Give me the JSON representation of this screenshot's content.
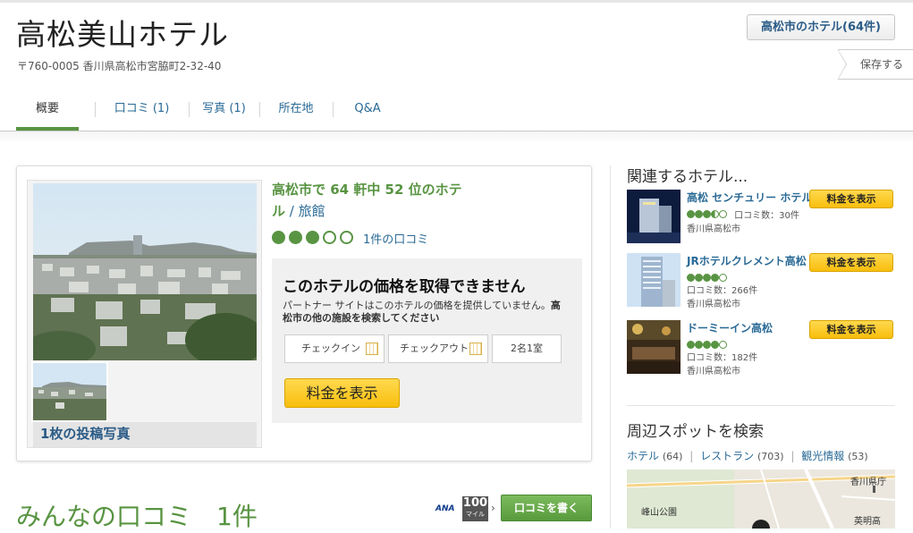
{
  "hotel": {
    "name": "高松美山ホテル",
    "address": "〒760-0005 香川県高松市宮脇町2-32-40"
  },
  "header": {
    "hotels_button": "高松市のホテル(64件)",
    "save_button": "保存する"
  },
  "tabs": [
    {
      "label": "概要",
      "active": true
    },
    {
      "label": "口コミ (1)"
    },
    {
      "label": "写真 (1)"
    },
    {
      "label": "所在地"
    },
    {
      "label": "Q&A"
    }
  ],
  "overview": {
    "photo_caption": "1枚の投稿写真",
    "rank_text": "高松市で 64 軒中 52 位のホテ",
    "rank_text2": "ル",
    "rank_type": " / 旅館",
    "rating": 3,
    "rating_max": 5,
    "reviews_link": "1件の口コミ"
  },
  "pricebox": {
    "title": "このホテルの価格を取得できません",
    "desc_plain": "パートナー サイトはこのホテルの価格を提供していません。",
    "desc_bold": "高松市の他の施設を検索してください",
    "checkin_label": "チェックイン",
    "checkout_label": "チェックアウト",
    "guests_label": "2名1室",
    "show_price_button": "料金を表示"
  },
  "reviews": {
    "heading": "みんなの口コミ　1件",
    "ana_logo": "ANA",
    "ana_miles": "100",
    "ana_miles_unit": "マイル",
    "write_button": "口コミを書く"
  },
  "related": {
    "title": "関連するホテル...",
    "hotels": [
      {
        "name": "高松 センチュリー ホテル",
        "rating": 3.5,
        "review_count": "口コミ数：30件",
        "location": "香川県高松市",
        "button": "料金を表示"
      },
      {
        "name": "JRホテルクレメント高松",
        "rating": 4,
        "review_count": "口コミ数：266件",
        "location": "香川県高松市",
        "button": "料金を表示"
      },
      {
        "name": "ドーミーイン高松",
        "rating": 4,
        "review_count": "口コミ数：182件",
        "location": "香川県高松市",
        "button": "料金を表示"
      }
    ]
  },
  "nearby": {
    "title": "周辺スポットを検索",
    "links": [
      {
        "label": "ホテル",
        "count": "(64)"
      },
      {
        "label": "レストラン",
        "count": "(703)"
      },
      {
        "label": "観光情報",
        "count": "(53)"
      }
    ],
    "map_labels": [
      "峰山公園",
      "香川県庁",
      "英明高"
    ]
  },
  "colors": {
    "accent_green": "#589442",
    "link_blue": "#2a6a96",
    "button_yellow": "#f8be0d"
  }
}
